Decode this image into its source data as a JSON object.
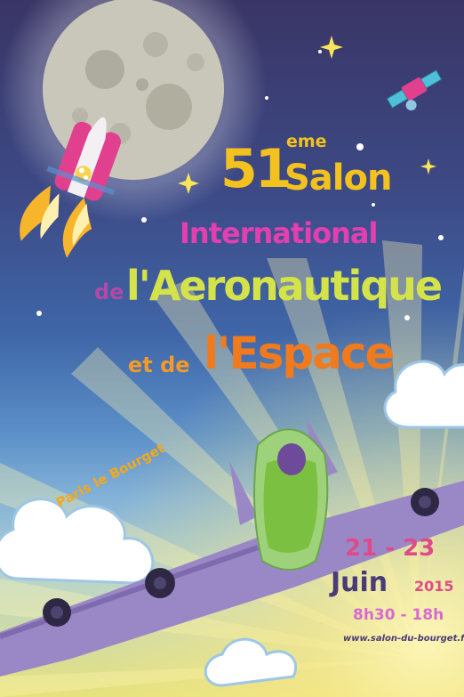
{
  "poster": {
    "edition_number": "51",
    "edition_suffix": "eme",
    "salon": "Salon",
    "international": "International",
    "de": "de",
    "aeronautique": "l'Aeronautique",
    "et_de": "et de",
    "espace": "l'Espace",
    "location": "Paris le Bourget",
    "dates": "21 - 23",
    "month": "Juin",
    "year": "2015",
    "hours": "8h30 - 18h",
    "website": "www.salon-du-bourget.fr"
  },
  "colors": {
    "sky_top": "#3a3566",
    "sky_bottom": "#e7e27c",
    "moon": "#c8c6b8",
    "plane_body": "#9ed27a",
    "plane_wing": "#9a88c6",
    "title_yellow": "#f3c21e",
    "title_pink": "#e33fb0",
    "title_green": "#d4e34a",
    "title_orange": "#f07a1e"
  },
  "icons": [
    "moon-icon",
    "rocket-icon",
    "satellite-icon",
    "star-icon",
    "cloud-icon",
    "airplane-icon",
    "sun-rays-icon"
  ]
}
